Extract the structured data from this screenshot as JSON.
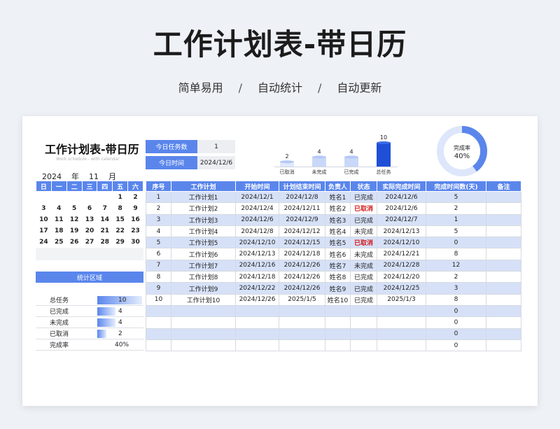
{
  "hero": {
    "title": "工作计划表-带日历",
    "features": [
      "简单易用",
      "自动统计",
      "自动更新"
    ],
    "separator": "/"
  },
  "sheet": {
    "title": "工作计划表-带日历",
    "subtitle": "Work schedule - with calendar"
  },
  "info": {
    "task_count_label": "今日任务数",
    "task_count_value": "1",
    "date_label": "今日时间",
    "date_value": "2024/12/6"
  },
  "bar_chart": {
    "categories": [
      "已取消",
      "未完成",
      "已完成",
      "总任务"
    ],
    "values": [
      2,
      4,
      4,
      10
    ]
  },
  "donut": {
    "label": "完成率",
    "value_text": "40%",
    "fraction": 0.4
  },
  "calendar": {
    "year": "2024",
    "year_unit": "年",
    "month": "11",
    "month_unit": "月",
    "weekdays": [
      "日",
      "一",
      "二",
      "三",
      "四",
      "五",
      "六"
    ],
    "weeks": [
      [
        "",
        "",
        "",
        "",
        "",
        "1",
        "2"
      ],
      [
        "3",
        "4",
        "5",
        "6",
        "7",
        "8",
        "9"
      ],
      [
        "10",
        "11",
        "12",
        "13",
        "14",
        "15",
        "16"
      ],
      [
        "17",
        "18",
        "19",
        "20",
        "21",
        "22",
        "23"
      ],
      [
        "24",
        "25",
        "26",
        "27",
        "28",
        "29",
        "30"
      ]
    ]
  },
  "stats": {
    "header": "统计区域",
    "rows": [
      {
        "label": "总任务",
        "value": "10",
        "fraction": 1.0
      },
      {
        "label": "已完成",
        "value": "4",
        "fraction": 0.4
      },
      {
        "label": "未完成",
        "value": "4",
        "fraction": 0.4
      },
      {
        "label": "已取消",
        "value": "2",
        "fraction": 0.2
      }
    ],
    "rate_label": "完成率",
    "rate_value": "40%"
  },
  "table": {
    "headers": [
      "序号",
      "工作计划",
      "开始时间",
      "计划结束时间",
      "负责人",
      "状态",
      "实际完成时间",
      "完成时间数(天)",
      "备注"
    ],
    "rows": [
      [
        "1",
        "工作计划1",
        "2024/12/1",
        "2024/12/8",
        "姓名1",
        "已完成",
        "2024/12/6",
        "5",
        ""
      ],
      [
        "2",
        "工作计划2",
        "2024/12/4",
        "2024/12/11",
        "姓名2",
        "已取消",
        "2024/12/6",
        "2",
        ""
      ],
      [
        "3",
        "工作计划3",
        "2024/12/6",
        "2024/12/9",
        "姓名3",
        "已完成",
        "2024/12/7",
        "1",
        ""
      ],
      [
        "4",
        "工作计划4",
        "2024/12/8",
        "2024/12/12",
        "姓名4",
        "未完成",
        "2024/12/13",
        "5",
        ""
      ],
      [
        "5",
        "工作计划5",
        "2024/12/10",
        "2024/12/15",
        "姓名5",
        "已取消",
        "2024/12/10",
        "0",
        ""
      ],
      [
        "6",
        "工作计划6",
        "2024/12/13",
        "2024/12/18",
        "姓名6",
        "未完成",
        "2024/12/21",
        "8",
        ""
      ],
      [
        "7",
        "工作计划7",
        "2024/12/16",
        "2024/12/26",
        "姓名7",
        "未完成",
        "2024/12/28",
        "12",
        ""
      ],
      [
        "8",
        "工作计划8",
        "2024/12/18",
        "2024/12/26",
        "姓名8",
        "已完成",
        "2024/12/20",
        "2",
        ""
      ],
      [
        "9",
        "工作计划9",
        "2024/12/22",
        "2024/12/26",
        "姓名9",
        "已完成",
        "2024/12/25",
        "3",
        ""
      ],
      [
        "10",
        "工作计划10",
        "2024/12/26",
        "2025/1/5",
        "姓名10",
        "已完成",
        "2025/1/3",
        "8",
        ""
      ],
      [
        "",
        "",
        "",
        "",
        "",
        "",
        "",
        "0",
        ""
      ],
      [
        "",
        "",
        "",
        "",
        "",
        "",
        "",
        "0",
        ""
      ],
      [
        "",
        "",
        "",
        "",
        "",
        "",
        "",
        "0",
        ""
      ],
      [
        "",
        "",
        "",
        "",
        "",
        "",
        "",
        "0",
        ""
      ]
    ],
    "cancel_status": "已取消"
  },
  "colors": {
    "accent": "#5a86ec",
    "bar_light": "#c9d8f9",
    "bar_dark": "#1f4fd6",
    "donut_track": "#dde6fb",
    "cancel_text": "#d21b1b"
  }
}
